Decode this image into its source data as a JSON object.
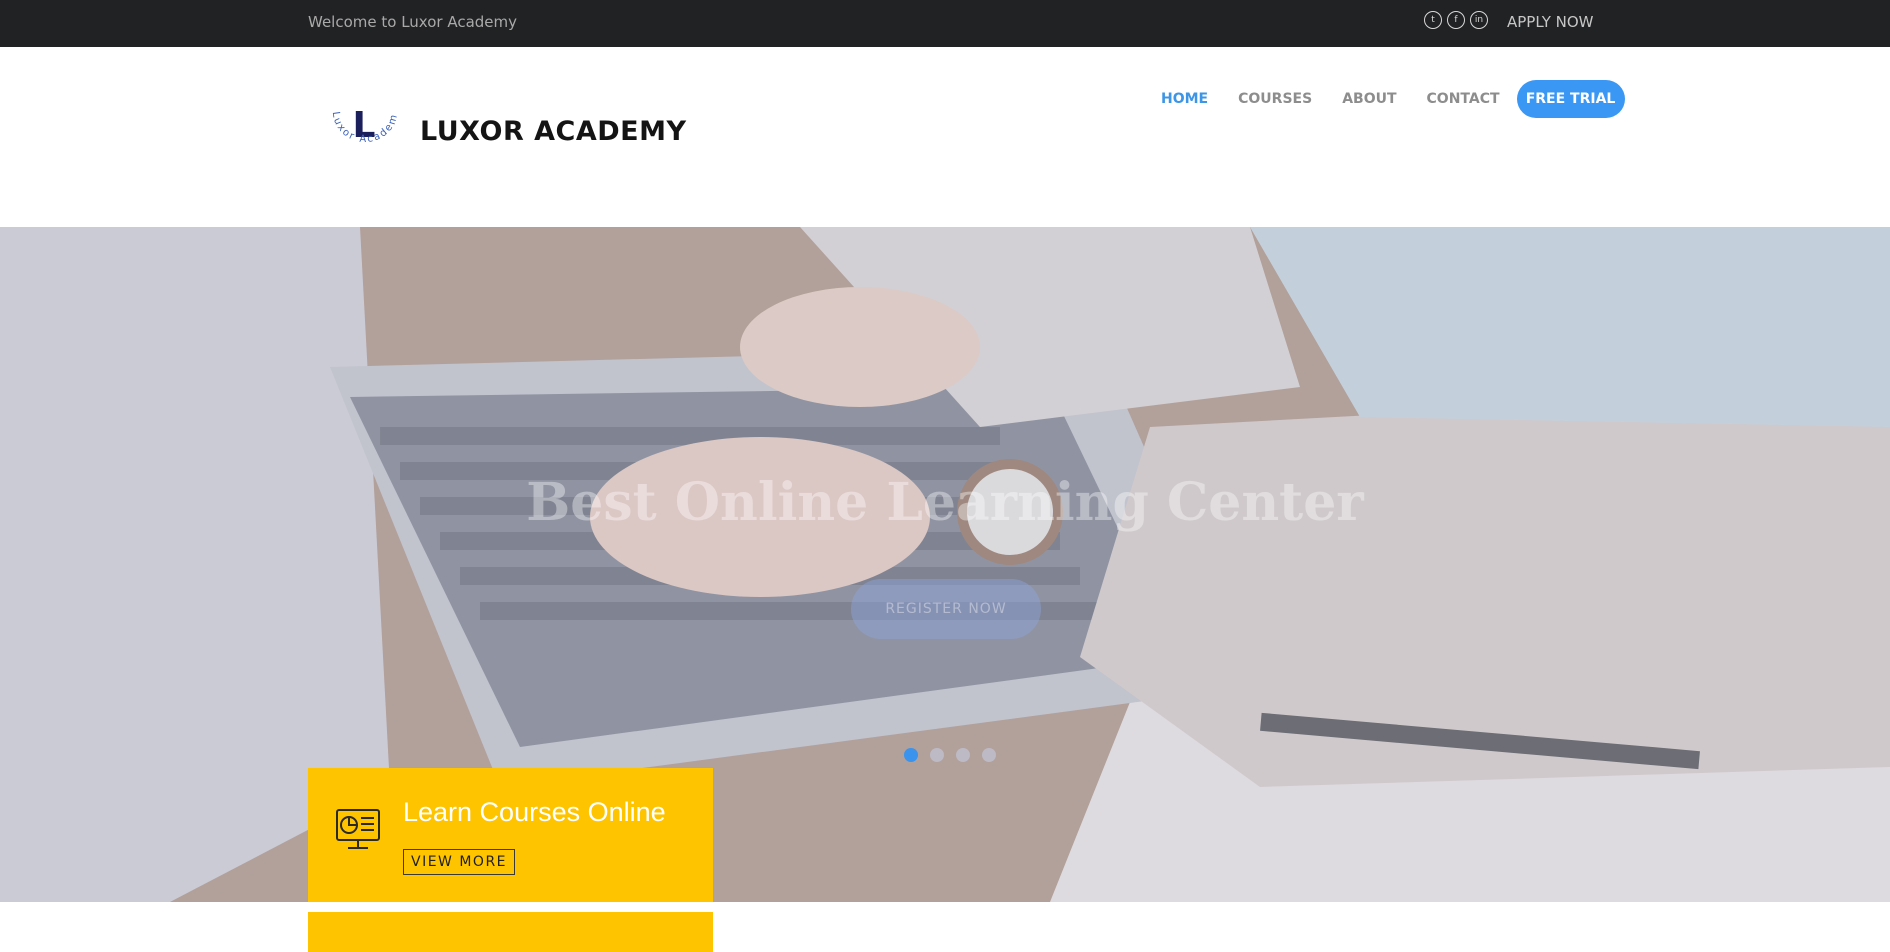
{
  "topbar": {
    "welcome": "Welcome to Luxor Academy",
    "social_icons": [
      "twitter-icon",
      "facebook-icon",
      "linkedin-icon"
    ],
    "apply": "APPLY NOW"
  },
  "header": {
    "logo_letter": "L",
    "logo_ring_text": "Luxor Academy",
    "brand": "LUXOR ACADEMY",
    "nav": [
      {
        "label": "HOME",
        "active": true
      },
      {
        "label": "COURSES",
        "active": false
      },
      {
        "label": "ABOUT",
        "active": false
      },
      {
        "label": "CONTACT",
        "active": false
      }
    ],
    "cta": "FREE TRIAL"
  },
  "hero": {
    "title": "Best Online Learning Center",
    "button": "REGISTER NOW",
    "slide_count": 4,
    "active_slide": 1
  },
  "cards": [
    {
      "title": "Learn Courses Online",
      "button": "VIEW MORE",
      "icon": "computer-monitor-icon"
    }
  ],
  "colors": {
    "accent_blue": "#3b97f4",
    "nav_active": "#3c95e6",
    "card_yellow": "#ffc400",
    "topbar_bg": "#212224"
  }
}
